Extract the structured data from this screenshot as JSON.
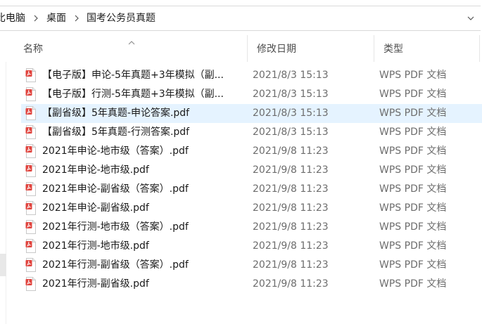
{
  "breadcrumb": {
    "items": [
      "此电脑",
      "桌面",
      "国考公务员真题"
    ],
    "visible_items": [
      "比电脑",
      "桌面",
      "国考公务员真题"
    ]
  },
  "columns": {
    "name": "名称",
    "date": "修改日期",
    "type": "类型"
  },
  "files": [
    {
      "name": "【电子版】申论-5年真题+3年模拟（副...",
      "date": "2021/8/3 15:13",
      "type": "WPS PDF 文档"
    },
    {
      "name": "【电子版】行测-5年真题+3年模拟（副...",
      "date": "2021/8/3 15:13",
      "type": "WPS PDF 文档"
    },
    {
      "name": "【副省级】5年真题-申论答案.pdf",
      "date": "2021/8/3 15:13",
      "type": "WPS PDF 文档"
    },
    {
      "name": "【副省级】5年真题-行测答案.pdf",
      "date": "2021/8/3 15:13",
      "type": "WPS PDF 文档"
    },
    {
      "name": "2021年申论-地市级（答案）.pdf",
      "date": "2021/9/8 11:23",
      "type": "WPS PDF 文档"
    },
    {
      "name": "2021年申论-地市级.pdf",
      "date": "2021/9/8 11:23",
      "type": "WPS PDF 文档"
    },
    {
      "name": "2021年申论-副省级（答案）.pdf",
      "date": "2021/9/8 11:23",
      "type": "WPS PDF 文档"
    },
    {
      "name": "2021年申论-副省级.pdf",
      "date": "2021/9/8 11:23",
      "type": "WPS PDF 文档"
    },
    {
      "name": "2021年行测-地市级（答案）.pdf",
      "date": "2021/9/8 11:23",
      "type": "WPS PDF 文档"
    },
    {
      "name": "2021年行测-地市级.pdf",
      "date": "2021/9/8 11:23",
      "type": "WPS PDF 文档"
    },
    {
      "name": "2021年行测-副省级（答案）.pdf",
      "date": "2021/9/8 11:23",
      "type": "WPS PDF 文档"
    },
    {
      "name": "2021年行测-副省级.pdf",
      "date": "2021/9/8 11:23",
      "type": "WPS PDF 文档"
    }
  ],
  "hovered_row": 2,
  "icons": {
    "file": "pdf-file-icon",
    "separator": "chevron-right-icon",
    "sort": "sort-ascending-icon",
    "address_dropdown": "chevron-down-icon"
  },
  "colors": {
    "pdf_red": "#e0443e",
    "hover": "#e5f3ff"
  }
}
